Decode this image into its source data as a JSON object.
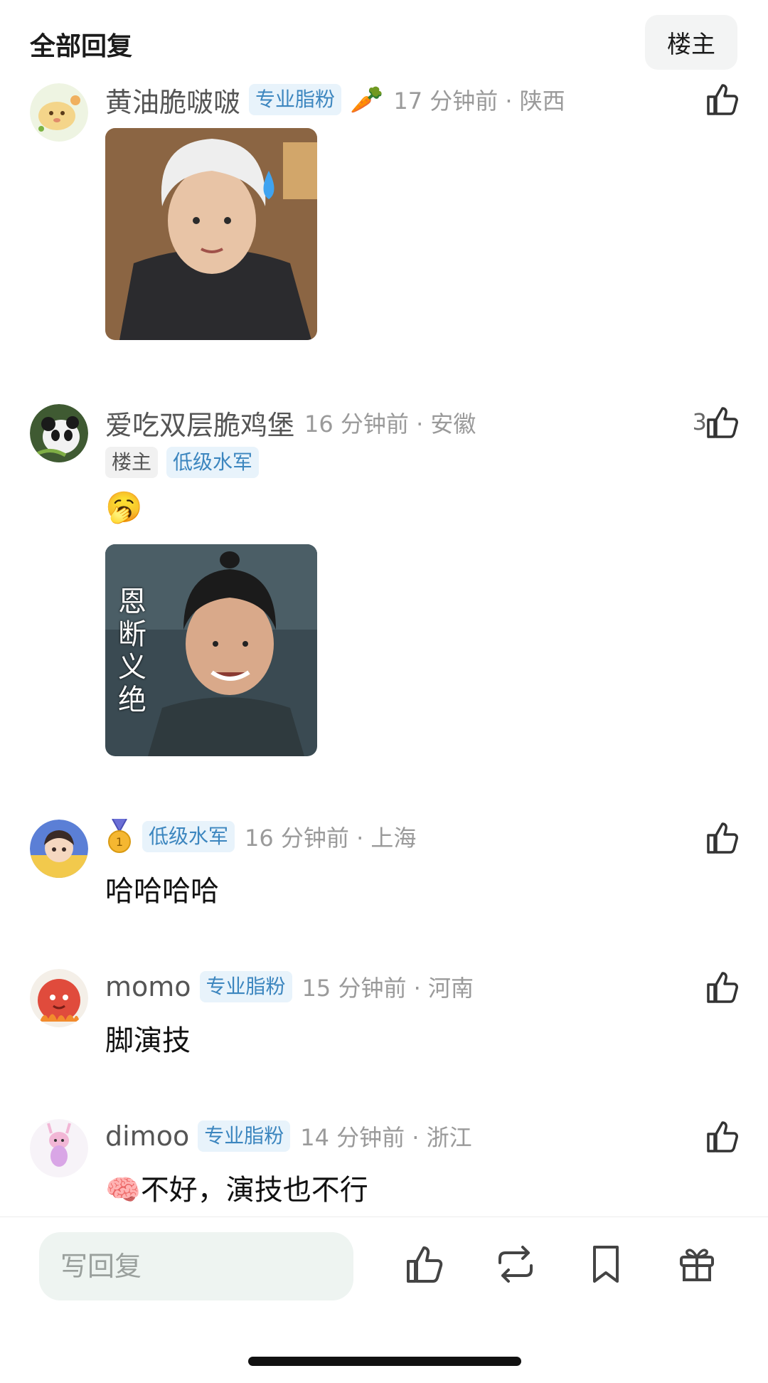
{
  "header": {
    "title": "全部回复",
    "filter_label": "楼主"
  },
  "comments": [
    {
      "username": "黄油脆啵啵",
      "badges": [
        "专业脂粉"
      ],
      "emoji": "🥕",
      "time": "17 分钟前 · 陕西",
      "sticker": "platinum-hair-guy-sweat-sticker"
    },
    {
      "username": "爱吃双层脆鸡堡",
      "time": "16 分钟前 · 安徽",
      "likes": "3",
      "badges": [
        "楼主",
        "低级水军"
      ],
      "text_emoji": "🥱",
      "sticker_text": "恩断义绝"
    },
    {
      "username": "",
      "medal_icon": "gold-medal-icon",
      "badges": [
        "低级水军"
      ],
      "time": "16 分钟前 · 上海",
      "text": "哈哈哈哈"
    },
    {
      "username": "momo",
      "badges": [
        "专业脂粉"
      ],
      "time": "15 分钟前 · 河南",
      "text": "脚演技"
    },
    {
      "username": "dimoo",
      "badges": [
        "专业脂粉"
      ],
      "time": "14 分钟前 · 浙江",
      "text_emoji": "🧠",
      "text": "不好，演技也不行"
    }
  ],
  "bottom_bar": {
    "reply_placeholder": "写回复",
    "icons": [
      "thumbs-up-icon",
      "repost-icon",
      "bookmark-icon",
      "gift-icon"
    ]
  },
  "colors": {
    "badge_bg": "#e8f3fb",
    "badge_text": "#3c86bf",
    "reply_bg": "#eef4f1"
  }
}
